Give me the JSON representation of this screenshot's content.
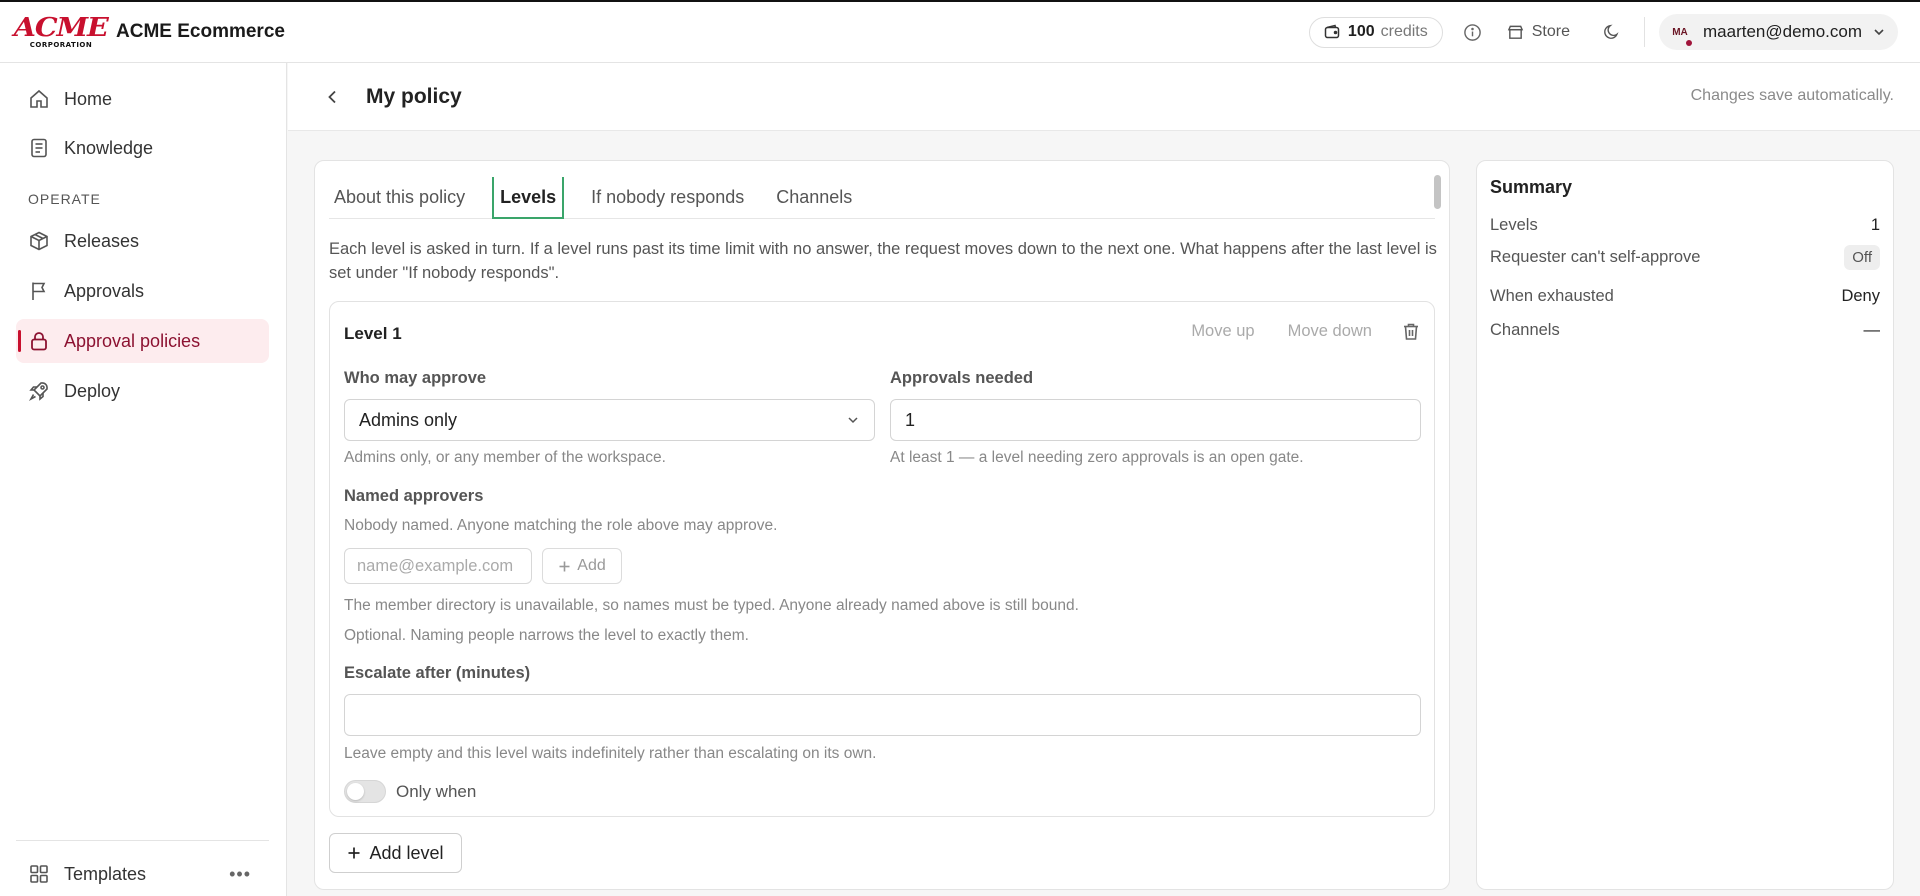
{
  "header": {
    "logo_text": "ACME",
    "logo_subtext": "CORPORATION",
    "app_name": "ACME Ecommerce",
    "credits_value": "100",
    "credits_label": "credits",
    "store_label": "Store",
    "user_initials": "MA",
    "user_email": "maarten@demo.com"
  },
  "sidebar": {
    "items_top": [
      {
        "label": "Home",
        "icon": "home-icon"
      },
      {
        "label": "Knowledge",
        "icon": "document-icon"
      }
    ],
    "section_label": "OPERATE",
    "items_operate": [
      {
        "label": "Releases",
        "icon": "box-icon"
      },
      {
        "label": "Approvals",
        "icon": "flag-icon"
      },
      {
        "label": "Approval policies",
        "icon": "lock-icon",
        "active": true
      },
      {
        "label": "Deploy",
        "icon": "rocket-icon"
      }
    ],
    "footer_item": {
      "label": "Templates",
      "icon": "grid-icon"
    }
  },
  "page": {
    "title": "My policy",
    "autosave_note": "Changes save automatically."
  },
  "tabs": [
    {
      "label": "About this policy",
      "active": false
    },
    {
      "label": "Levels",
      "active": true
    },
    {
      "label": "If nobody responds",
      "active": false
    },
    {
      "label": "Channels",
      "active": false
    }
  ],
  "levels_tab": {
    "intro": "Each level is asked in turn. If a level runs past its time limit with no answer, the request moves down to the next one. What happens after the last level is set under \"If nobody responds\".",
    "level": {
      "title": "Level 1",
      "move_up_label": "Move up",
      "move_down_label": "Move down",
      "who_label": "Who may approve",
      "who_value": "Admins only",
      "who_hint": "Admins only, or any member of the workspace.",
      "approvals_label": "Approvals needed",
      "approvals_value": "1",
      "approvals_hint": "At least 1 — a level needing zero approvals is an open gate.",
      "named_label": "Named approvers",
      "named_empty": "Nobody named. Anyone matching the role above may approve.",
      "email_placeholder": "name@example.com",
      "add_label": "Add",
      "directory_note": "The member directory is unavailable, so names must be typed. Anyone already named above is still bound.",
      "optional_note": "Optional. Naming people narrows the level to exactly them.",
      "escalate_label": "Escalate after (minutes)",
      "escalate_value": "",
      "escalate_hint": "Leave empty and this level waits indefinitely rather than escalating on its own.",
      "only_when_label": "Only when",
      "only_when_on": false
    },
    "add_level_label": "Add level"
  },
  "summary": {
    "title": "Summary",
    "rows": [
      {
        "label": "Levels",
        "value": "1"
      },
      {
        "label": "Requester can't self-approve",
        "value": "Off"
      },
      {
        "label": "When exhausted",
        "value": "Deny"
      },
      {
        "label": "Channels",
        "value": "—"
      }
    ]
  },
  "colors": {
    "brand_red": "#c8102e",
    "active_nav_bg": "#fdecee",
    "active_nav_text": "#8c1231",
    "active_tab_accent": "#3aa56a"
  }
}
